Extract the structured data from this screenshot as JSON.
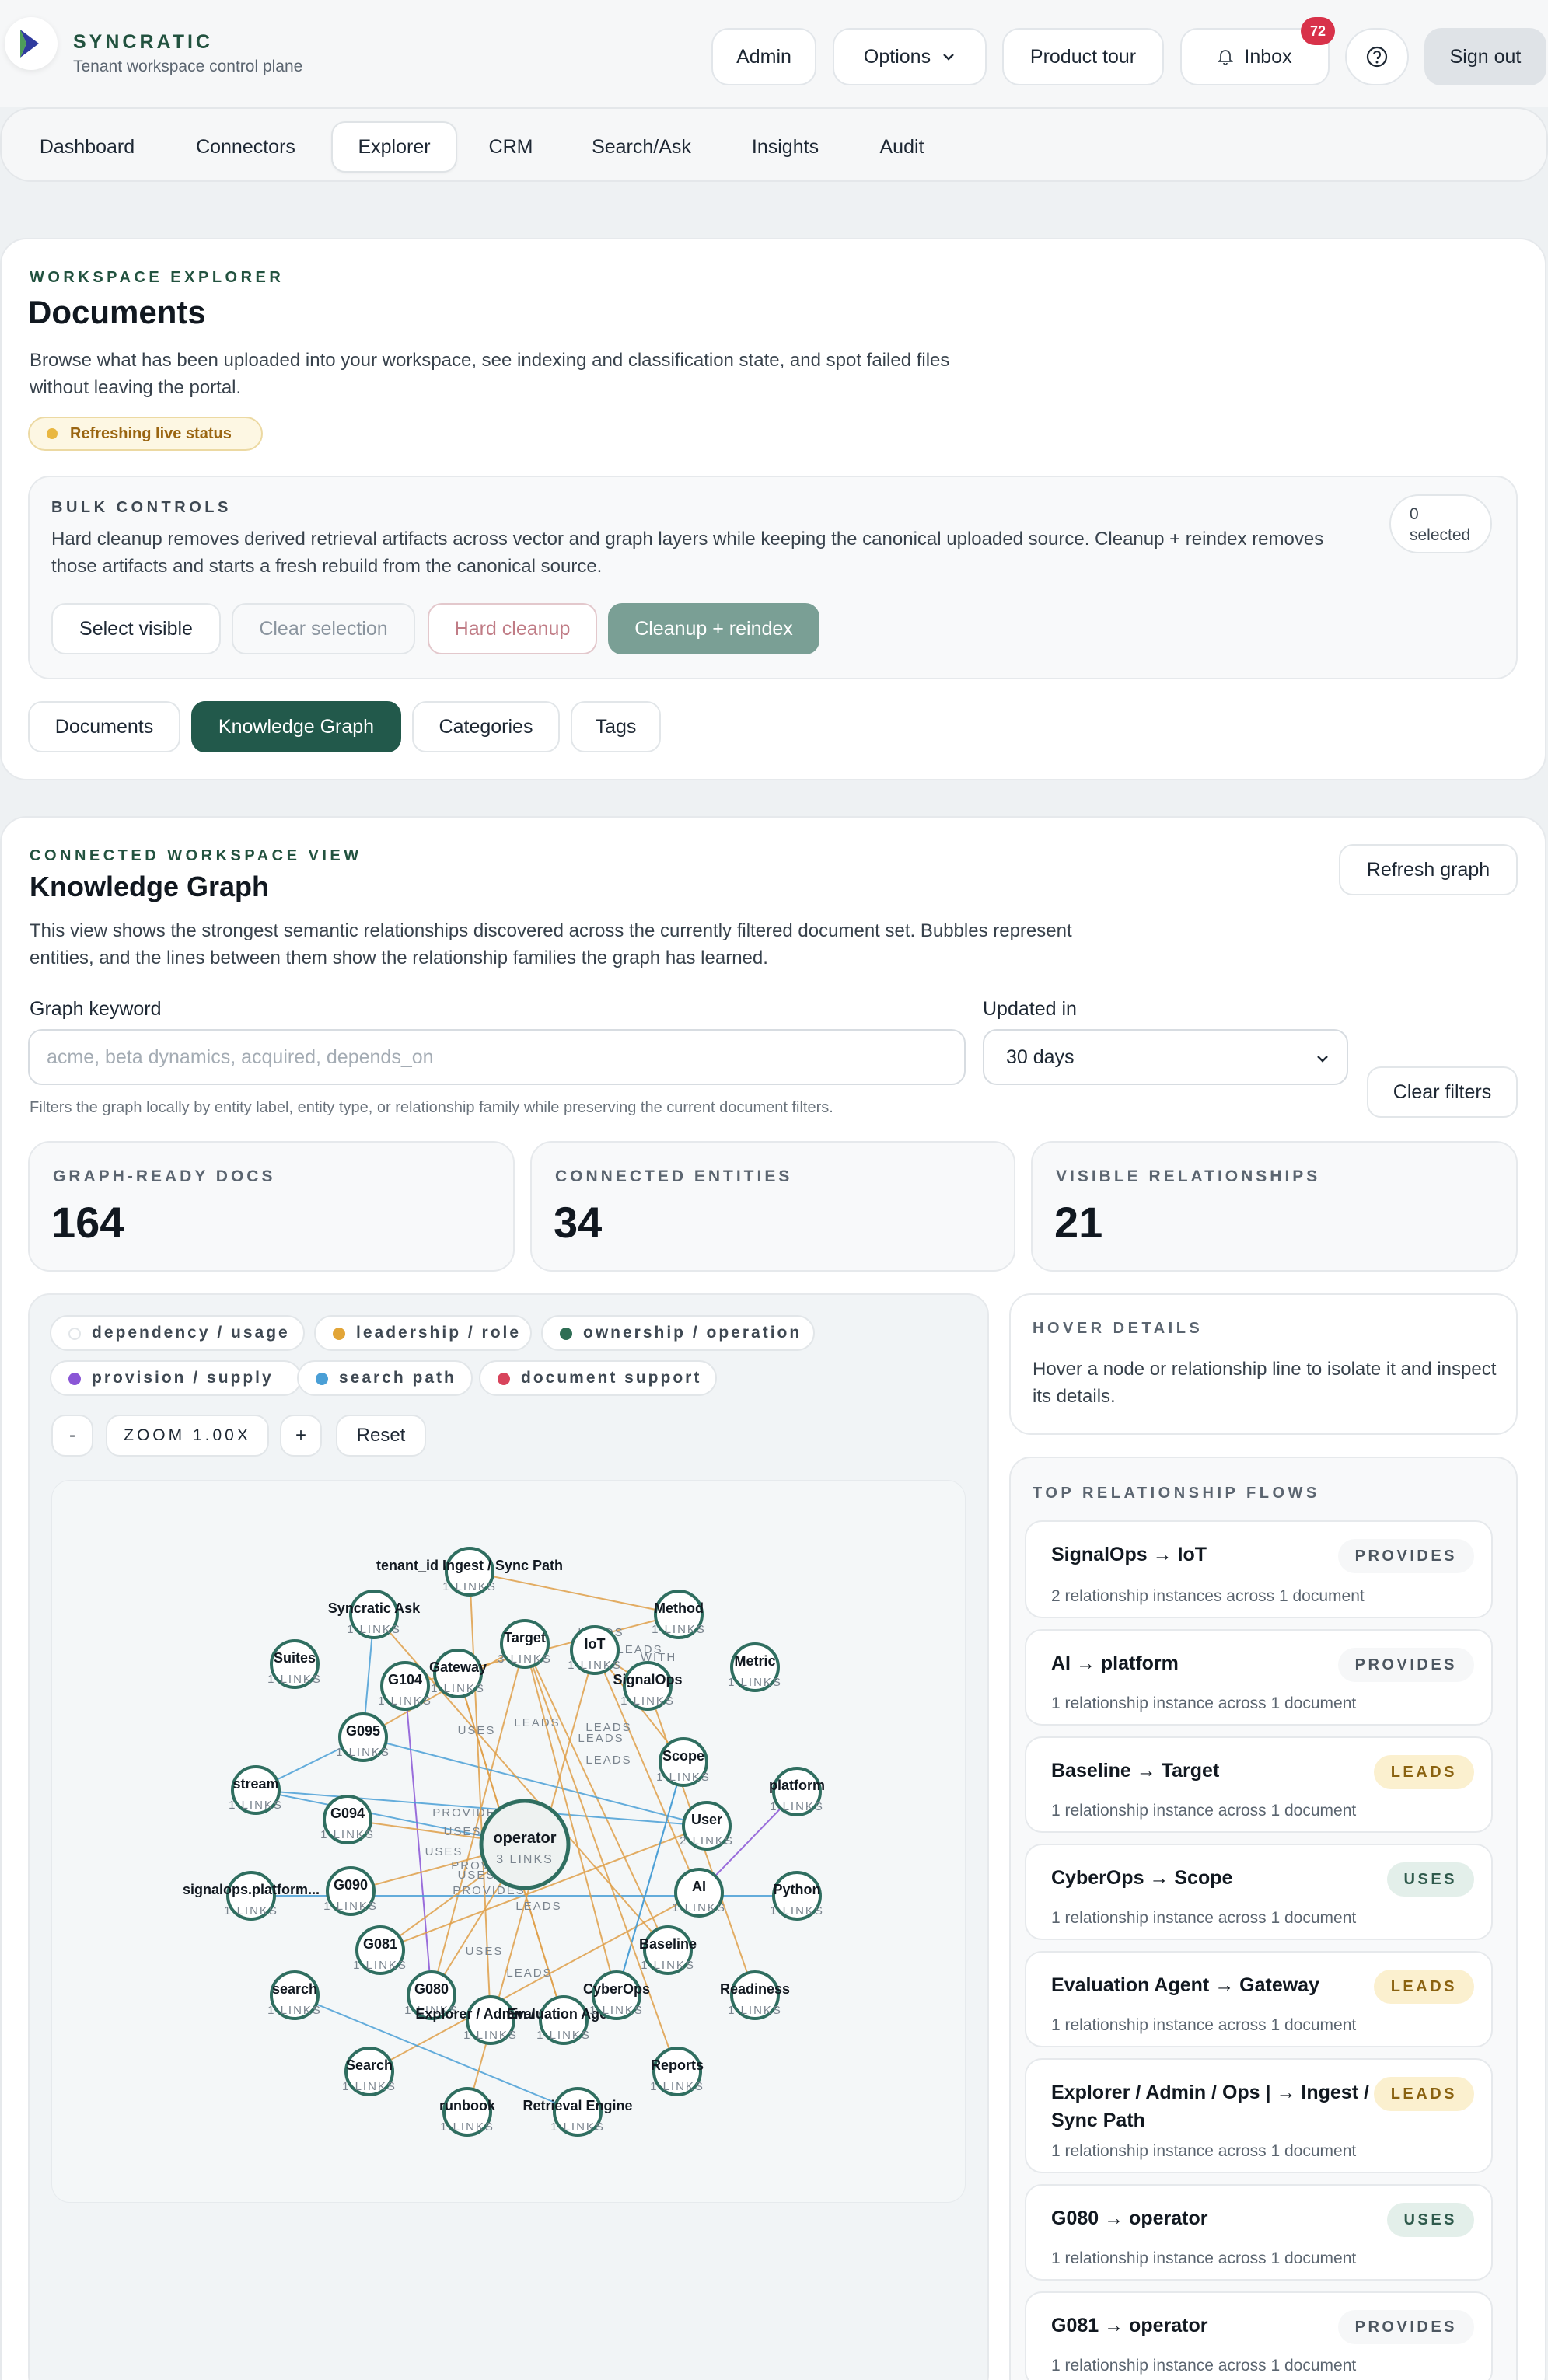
{
  "app": {
    "brand": "SYNCRATIC",
    "subtitle": "Tenant workspace control plane"
  },
  "header": {
    "admin": "Admin",
    "options": "Options",
    "tour": "Product tour",
    "inbox": "Inbox",
    "inbox_count": "72",
    "signout": "Sign out"
  },
  "nav": {
    "tabs": [
      "Dashboard",
      "Connectors",
      "Explorer",
      "CRM",
      "Search/Ask",
      "Insights",
      "Audit"
    ],
    "active": "Explorer"
  },
  "explorer": {
    "eyebrow": "WORKSPACE EXPLORER",
    "title": "Documents",
    "description": "Browse what has been uploaded into your workspace, see indexing and classification state, and spot failed files without leaving the portal.",
    "status": "Refreshing live status",
    "bulk": {
      "eyebrow": "BULK CONTROLS",
      "description": "Hard cleanup removes derived retrieval artifacts across vector and graph layers while keeping the canonical uploaded source. Cleanup + reindex removes those artifacts and starts a fresh rebuild from the canonical source.",
      "selected_count": "0",
      "selected_label": "selected",
      "select_visible": "Select visible",
      "clear_selection": "Clear selection",
      "hard_cleanup": "Hard cleanup",
      "cleanup_reindex": "Cleanup + reindex"
    },
    "subtabs": [
      "Documents",
      "Knowledge Graph",
      "Categories",
      "Tags"
    ],
    "active_subtab": "Knowledge Graph"
  },
  "graph": {
    "eyebrow": "CONNECTED WORKSPACE VIEW",
    "title": "Knowledge Graph",
    "refresh": "Refresh graph",
    "description": "This view shows the strongest semantic relationships discovered across the currently filtered document set. Bubbles represent entities, and the lines between them show the relationship families the graph has learned.",
    "keyword_label": "Graph keyword",
    "keyword_placeholder": "acme, beta dynamics, acquired, depends_on",
    "updated_label": "Updated in",
    "updated_value": "30 days",
    "clear_filters": "Clear filters",
    "hint": "Filters the graph locally by entity label, entity type, or relationship family while preserving the current document filters.",
    "stats": [
      {
        "label": "GRAPH-READY DOCS",
        "value": "164"
      },
      {
        "label": "CONNECTED ENTITIES",
        "value": "34"
      },
      {
        "label": "VISIBLE RELATIONSHIPS",
        "value": "21"
      }
    ],
    "legend": [
      {
        "label": "dependency / usage",
        "color": "#ffffff"
      },
      {
        "label": "leadership / role",
        "color": "#e2a537"
      },
      {
        "label": "ownership / operation",
        "color": "#2f6e55"
      },
      {
        "label": "provision / supply",
        "color": "#8a56d6"
      },
      {
        "label": "search path",
        "color": "#4a9fd6"
      },
      {
        "label": "document support",
        "color": "#d8445c"
      }
    ],
    "zoom_minus": "-",
    "zoom_label": "ZOOM 1.00X",
    "zoom_plus": "+",
    "reset": "Reset",
    "link_suffix": "LINKS",
    "nodes": [
      {
        "label": "operator",
        "sub": "3 LINKS"
      },
      {
        "label": "tenant_id Ingest / Sync Path",
        "sub": "1 LINKS"
      },
      {
        "label": "Syncratic Ask",
        "sub": "1 LINKS"
      },
      {
        "label": "Method",
        "sub": "1 LINKS"
      },
      {
        "label": "Target",
        "sub": "3 LINKS"
      },
      {
        "label": "IoT",
        "sub": "1 LINKS"
      },
      {
        "label": "Gateway",
        "sub": "1 LINKS"
      },
      {
        "label": "SignalOps",
        "sub": "1 LINKS"
      },
      {
        "label": "Suites",
        "sub": "1 LINKS"
      },
      {
        "label": "G104",
        "sub": "1 LINKS"
      },
      {
        "label": "Metric",
        "sub": "1 LINKS"
      },
      {
        "label": "G095",
        "sub": "1 LINKS"
      },
      {
        "label": "Scope",
        "sub": "1 LINKS"
      },
      {
        "label": "stream",
        "sub": "1 LINKS"
      },
      {
        "label": "platform",
        "sub": "1 LINKS"
      },
      {
        "label": "G094",
        "sub": "1 LINKS"
      },
      {
        "label": "User",
        "sub": "2 LINKS"
      },
      {
        "label": "signalops.platform...",
        "sub": "1 LINKS"
      },
      {
        "label": "G090",
        "sub": "1 LINKS"
      },
      {
        "label": "AI",
        "sub": "1 LINKS"
      },
      {
        "label": "Python",
        "sub": "1 LINKS"
      },
      {
        "label": "G081",
        "sub": "1 LINKS"
      },
      {
        "label": "Baseline",
        "sub": "1 LINKS"
      },
      {
        "label": "search",
        "sub": "1 LINKS"
      },
      {
        "label": "G080",
        "sub": "1 LINKS"
      },
      {
        "label": "Explorer / Admin / Ops",
        "sub": "1 LINKS"
      },
      {
        "label": "Evaluation Agent",
        "sub": "1 LINKS"
      },
      {
        "label": "CyberOps",
        "sub": "1 LINKS"
      },
      {
        "label": "Readiness",
        "sub": "1 LINKS"
      },
      {
        "label": "Search",
        "sub": "1 LINKS"
      },
      {
        "label": "Reports",
        "sub": "1 LINKS"
      },
      {
        "label": "runbook",
        "sub": "1 LINKS"
      },
      {
        "label": "Retrieval Engine",
        "sub": "1 LINKS"
      }
    ],
    "edge_labels": [
      "LEADS",
      "LEADS",
      "WITH",
      "USES",
      "LEADS",
      "LEADS",
      "LEADS",
      "LEADS",
      "PROVIDES",
      "USES",
      "USES",
      "PROVIDES",
      "USES",
      "LEADS",
      "PROVIDES",
      "USES",
      "LEADS"
    ],
    "hover": {
      "eyebrow": "HOVER DETAILS",
      "text": "Hover a node or relationship line to isolate it and inspect its details."
    },
    "flows_eyebrow": "TOP RELATIONSHIP FLOWS",
    "flows": [
      {
        "title": "SignalOps → IoT",
        "badge": "PROVIDES",
        "kind": "provides",
        "detail": "2 relationship instances across 1 document"
      },
      {
        "title": "AI → platform",
        "badge": "PROVIDES",
        "kind": "provides",
        "detail": "1 relationship instance across 1 document"
      },
      {
        "title": "Baseline → Target",
        "badge": "LEADS",
        "kind": "leads",
        "detail": "1 relationship instance across 1 document"
      },
      {
        "title": "CyberOps → Scope",
        "badge": "USES",
        "kind": "uses",
        "detail": "1 relationship instance across 1 document"
      },
      {
        "title": "Evaluation Agent → Gateway",
        "badge": "LEADS",
        "kind": "leads",
        "detail": "1 relationship instance across 1 document"
      },
      {
        "title": "Explorer / Admin / Ops | → Ingest / Sync Path",
        "badge": "LEADS",
        "kind": "leads",
        "detail": "1 relationship instance across 1 document"
      },
      {
        "title": "G080 → operator",
        "badge": "USES",
        "kind": "uses",
        "detail": "1 relationship instance across 1 document"
      },
      {
        "title": "G081 → operator",
        "badge": "PROVIDES",
        "kind": "provides",
        "detail": "1 relationship instance across 1 document"
      }
    ]
  }
}
